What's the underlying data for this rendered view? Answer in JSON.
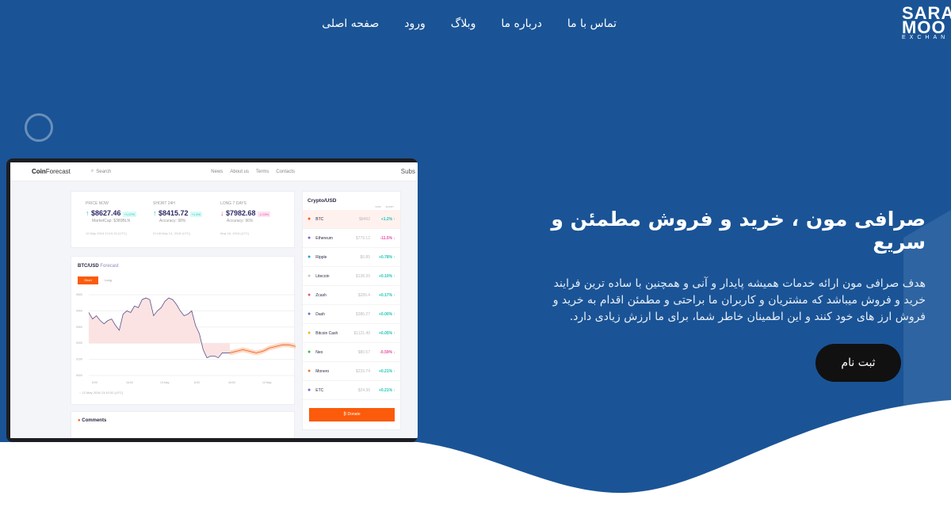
{
  "brand": {
    "line1": "SARA",
    "line2": "MOO",
    "line3": "EXCHAN"
  },
  "nav": [
    "صفحه اصلی",
    "ورود",
    "وبلاگ",
    "درباره ما",
    "تماس با ما"
  ],
  "hero": {
    "title": "صرافی مون ، خرید و فروش مطمئن و سریع",
    "text": "هدف صرافی مون ارائه خدمات همیشه پایدار و آنی و همچنین با ساده ترین فرایند خرید و فروش میباشد که مشتریان و کاربران ما براحتی و مطمئن اقدام به خرید و فروش ارز های خود کنند و این اطمینان خاطر شما، برای ما ارزش زیادی دارد.",
    "cta": "ثبت نام"
  },
  "colors": {
    "primary": "#1a5496",
    "cta": "#111111",
    "accent": "#fb5b0b"
  },
  "mockup": {
    "brand_bold": "Coin",
    "brand_rest": "Forecast",
    "search": "Search",
    "links": [
      "News",
      "About us",
      "Terms",
      "Contacts"
    ],
    "more": "Subs",
    "stats": [
      {
        "label": "PRICE NOW",
        "value": "$8627.46",
        "change": "+1.07%",
        "dir": "up",
        "sub": "MarketCap: $380BLN",
        "date": "12 May 2018 13:10:32 (UTC)"
      },
      {
        "label": "SHORT 24H",
        "value": "$8415.72",
        "change": "+1.4%",
        "dir": "up",
        "sub": "Accuracy: 98%",
        "date": "01:08 May 13, 2018 (UTC)"
      },
      {
        "label": "LONG 7 DAYS",
        "value": "$7982.68",
        "change": "-1.03%",
        "dir": "dn",
        "sub": "Accuracy: 96%",
        "date": "May 18, 2018 (UTC)"
      }
    ],
    "chart": {
      "title_bold": "BTC/USD",
      "title_rest": "Forecast",
      "tabs": [
        "Short",
        "Long"
      ],
      "yticks": [
        "9500",
        "9400",
        "9300",
        "9200",
        "9100",
        "9000"
      ],
      "xticks": [
        "8:00",
        "16:00",
        "13 May",
        "8:00",
        "16:00",
        "13 May"
      ],
      "date": "12 May 2018 13:10:32 (UTC)",
      "series": [
        9390,
        9350,
        9370,
        9340,
        9320,
        9340,
        9350,
        9310,
        9280,
        9380,
        9400,
        9390,
        9430,
        9420,
        9470,
        9480,
        9470,
        9370,
        9400,
        9420,
        9460,
        9480,
        9470,
        9440,
        9400,
        9370,
        9380,
        9400,
        9310,
        9260,
        9160,
        9110,
        9120,
        9120,
        9110,
        9140,
        9140,
        9140
      ],
      "forecast": [
        9140,
        9150,
        9160,
        9150,
        9140,
        9150,
        9170,
        9180,
        9190,
        9190,
        9180
      ]
    },
    "comments": "Comments",
    "crypto": {
      "title": "Crypto/USD",
      "cols": [
        "NOW",
        "SHORT"
      ],
      "rows": [
        {
          "name": "BTC",
          "price": "$8492",
          "change": "+1.2%",
          "dir": "up",
          "color": "#fb5b0b"
        },
        {
          "name": "Ethereum",
          "price": "$779.12",
          "change": "-11.5%",
          "dir": "dn",
          "color": "#8a5ad8"
        },
        {
          "name": "Ripple",
          "price": "$0.85",
          "change": "+0.78%",
          "dir": "up",
          "color": "#1fa5d8"
        },
        {
          "name": "Litecoin",
          "price": "$138.20",
          "change": "+0.10%",
          "dir": "up",
          "color": "#c8c8c8"
        },
        {
          "name": "Zcash",
          "price": "$289.4",
          "change": "+0.17%",
          "dir": "up",
          "color": "#e85a7a"
        },
        {
          "name": "Dash",
          "price": "$386.27",
          "change": "+0.00%",
          "dir": "up",
          "color": "#5a78d8"
        },
        {
          "name": "Bitcoin Cash",
          "price": "$1121.49",
          "change": "+0.05%",
          "dir": "up",
          "color": "#f0b818"
        },
        {
          "name": "Neo",
          "price": "$80.57",
          "change": "-0.59%",
          "dir": "dn",
          "color": "#3ab84a"
        },
        {
          "name": "Monero",
          "price": "$233.74",
          "change": "+0.21%",
          "dir": "up",
          "color": "#f07a2a"
        },
        {
          "name": "ETC",
          "price": "$24.36",
          "change": "+0.21%",
          "dir": "up",
          "color": "#6a6ad8"
        }
      ],
      "donate": "Donate"
    }
  }
}
